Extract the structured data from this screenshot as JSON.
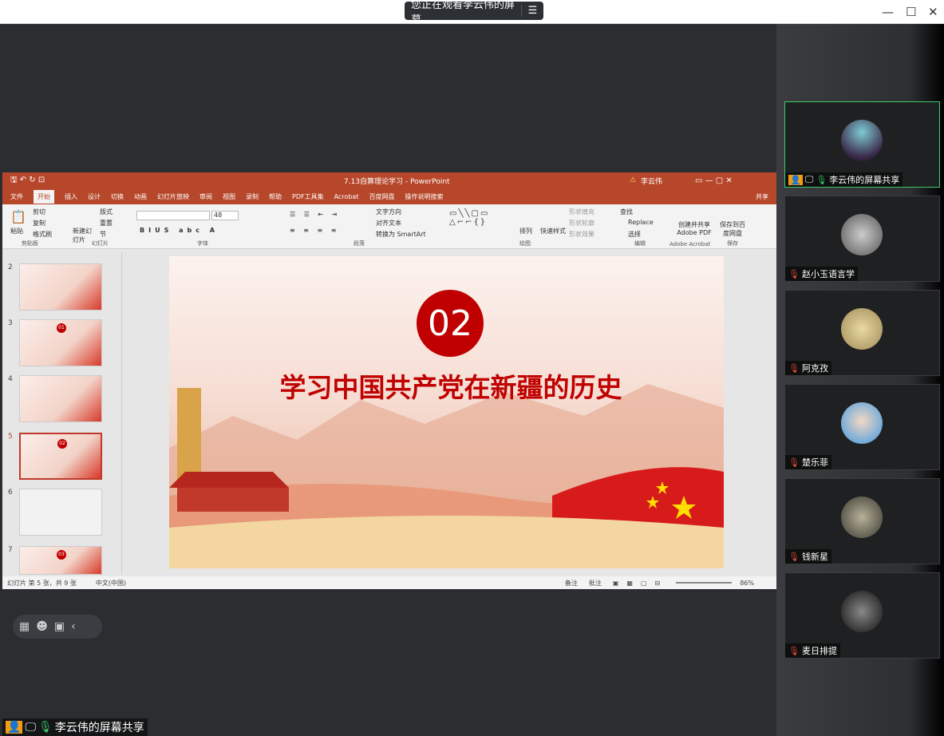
{
  "banner": {
    "text": "您正在观看李云伟的屏幕",
    "menu_icon": "menu-icon"
  },
  "window": {
    "minimize": "—",
    "maximize": "☐",
    "close": "✕"
  },
  "ppt": {
    "title": "7.13自算理论学习  -  PowerPoint",
    "user": "李云伟",
    "tabs": [
      "文件",
      "开始",
      "插入",
      "设计",
      "切换",
      "动画",
      "幻灯片放映",
      "审阅",
      "视图",
      "录制",
      "帮助",
      "PDF工具集",
      "Acrobat",
      "百度网盘",
      "操作说明搜索"
    ],
    "share": "共享",
    "ribbon": {
      "paste": "粘贴",
      "cut": "剪切",
      "copy": "复制",
      "format_painter": "格式刷",
      "new_slide": "新建幻灯片",
      "layout": "版式",
      "reset": "重置",
      "section": "节",
      "find": "查找",
      "replace": "Replace",
      "select": "选择",
      "adobe": "创建并共享 Adobe PDF",
      "baidu": "保存到百度网盘",
      "text_direction": "文字方向",
      "align_text": "对齐文本",
      "smartart": "转换为 SmartArt",
      "arrange": "排列",
      "quick_styles": "快速样式",
      "fill": "形状填充",
      "outline": "形状轮廓",
      "effects": "形状效果",
      "font_size": "48"
    },
    "groups": [
      "剪贴板",
      "幻灯片",
      "字体",
      "段落",
      "绘图",
      "编辑",
      "Adobe Acrobat",
      "保存"
    ],
    "thumbs": [
      {
        "n": "2"
      },
      {
        "n": "3",
        "badge": "01"
      },
      {
        "n": "4"
      },
      {
        "n": "5",
        "badge": "02"
      },
      {
        "n": "6"
      },
      {
        "n": "7",
        "badge": "03"
      }
    ],
    "slide": {
      "number": "02",
      "heading": "学习中国共产党在新疆的历史"
    },
    "status": {
      "slide_info": "幻灯片 第 5 张，共 9 张",
      "lang": "中文(中国)",
      "notes": "备注",
      "comments": "批注",
      "zoom": "86%"
    }
  },
  "participants": [
    {
      "name": "李云伟的屏幕共享",
      "active": true
    },
    {
      "name": "赵小玉语言学"
    },
    {
      "name": "阿克孜"
    },
    {
      "name": "楚乐菲"
    },
    {
      "name": "钱新星"
    },
    {
      "name": "麦日排提"
    }
  ],
  "bottom_label": "李云伟的屏幕共享",
  "colors": {
    "ppt_accent": "#b7472a",
    "active_border": "#3ecb6b",
    "slide_red": "#c00000"
  }
}
